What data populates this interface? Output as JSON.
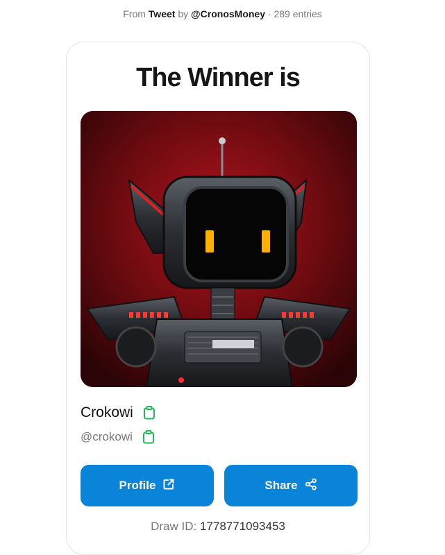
{
  "header": {
    "from_label": "From",
    "source_name": "Tweet",
    "by_label": "by",
    "author": "@CronosMoney",
    "separator": "·",
    "entries": "289 entries"
  },
  "card": {
    "title": "The Winner is",
    "winner": {
      "name": "Crokowi",
      "handle": "@crokowi",
      "avatar_icon": "robot-avatar-image"
    },
    "buttons": {
      "profile_label": "Profile",
      "profile_icon": "external-link-icon",
      "share_label": "Share",
      "share_icon": "share-icon"
    },
    "draw": {
      "label": "Draw ID:",
      "id": "1778771093453"
    }
  },
  "colors": {
    "button_bg": "#0a84d8",
    "copy_icon": "#1db954",
    "art_bg": "#6b0b0f"
  }
}
